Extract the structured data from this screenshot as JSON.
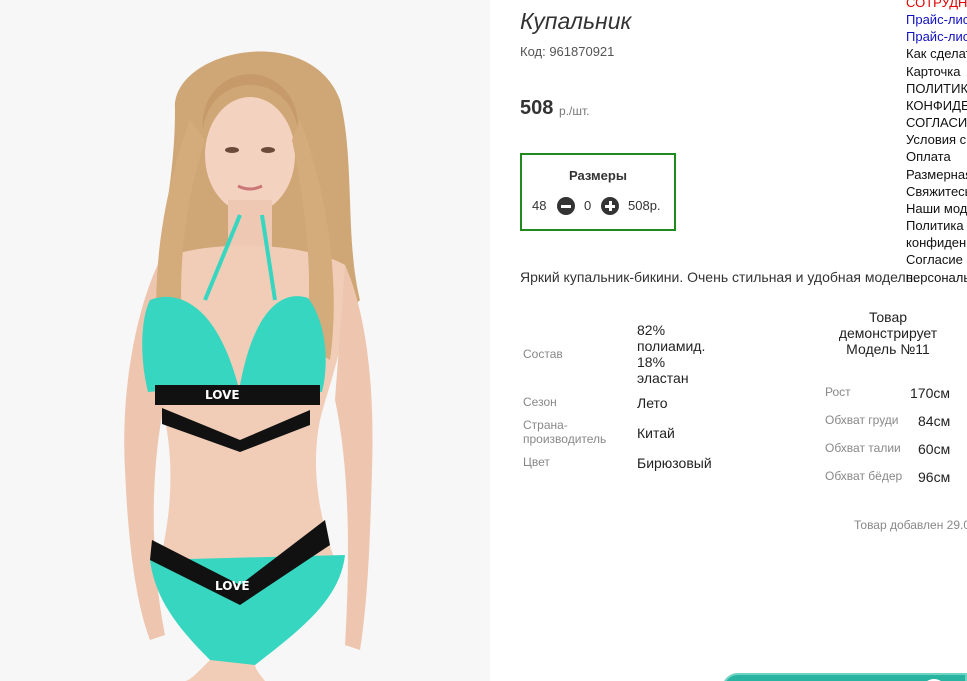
{
  "product": {
    "title": "Купальник",
    "code": "Код: 961870921",
    "price": "508",
    "price_unit": "р./шт.",
    "description": "Яркий купальник-бикини. Очень стильная и удобная модель."
  },
  "sizes": {
    "title": "Размеры",
    "rows": [
      {
        "size": "48",
        "qty": "0",
        "sum": "508р."
      }
    ]
  },
  "properties": [
    {
      "label": "Состав",
      "value": "82% полиамид. 18% эластан"
    },
    {
      "label": "Сезон",
      "value": "Лето"
    },
    {
      "label": "Страна-производитель",
      "value": "Китай"
    },
    {
      "label": "Цвет",
      "value": "Бирюзовый"
    }
  ],
  "model": {
    "title": "Товар демонстрирует Модель №11",
    "params": [
      {
        "label": "Рост",
        "value": "170см"
      },
      {
        "label": "Обхват груди",
        "value": "84см"
      },
      {
        "label": "Обхват талии",
        "value": "60см"
      },
      {
        "label": "Обхват бёдер",
        "value": "96см"
      }
    ]
  },
  "added_text": "Товар добавлен 29.0",
  "menu": [
    {
      "label": "СОТРУДНИЧЕСТВО",
      "style": "red"
    },
    {
      "label": "Прайс-лист",
      "style": "blue"
    },
    {
      "label": "Прайс-лист",
      "style": "blue"
    },
    {
      "label": "Как сделать заказ",
      "style": "normal"
    },
    {
      "label": "Карточка",
      "style": "normal"
    },
    {
      "label": "ПОЛИТИКА",
      "style": "normal"
    },
    {
      "label": "КОНФИДЕНЦИАЛЬНОСТИ",
      "style": "normal"
    },
    {
      "label": "СОГЛАСИЕ",
      "style": "normal"
    },
    {
      "label": "Условия сотрудничества",
      "style": "normal"
    },
    {
      "label": "Оплата",
      "style": "normal"
    },
    {
      "label": "Размерная сетка",
      "style": "normal"
    },
    {
      "label": "Свяжитесь с нами",
      "style": "normal"
    },
    {
      "label": "Наши модели",
      "style": "normal"
    },
    {
      "label": "Политика",
      "style": "normal"
    },
    {
      "label": "конфиденциальности",
      "style": "normal"
    },
    {
      "label": "Согласие",
      "style": "normal"
    },
    {
      "label": "персональных",
      "style": "normal"
    }
  ],
  "photo": {
    "print_text": "LOVE"
  },
  "colors": {
    "accent_green": "#1f8b1f",
    "swimsuit": "#36d6c0",
    "teal_button": "#29b3a1",
    "menu_red": "#e00000",
    "menu_blue": "#1010c0"
  }
}
